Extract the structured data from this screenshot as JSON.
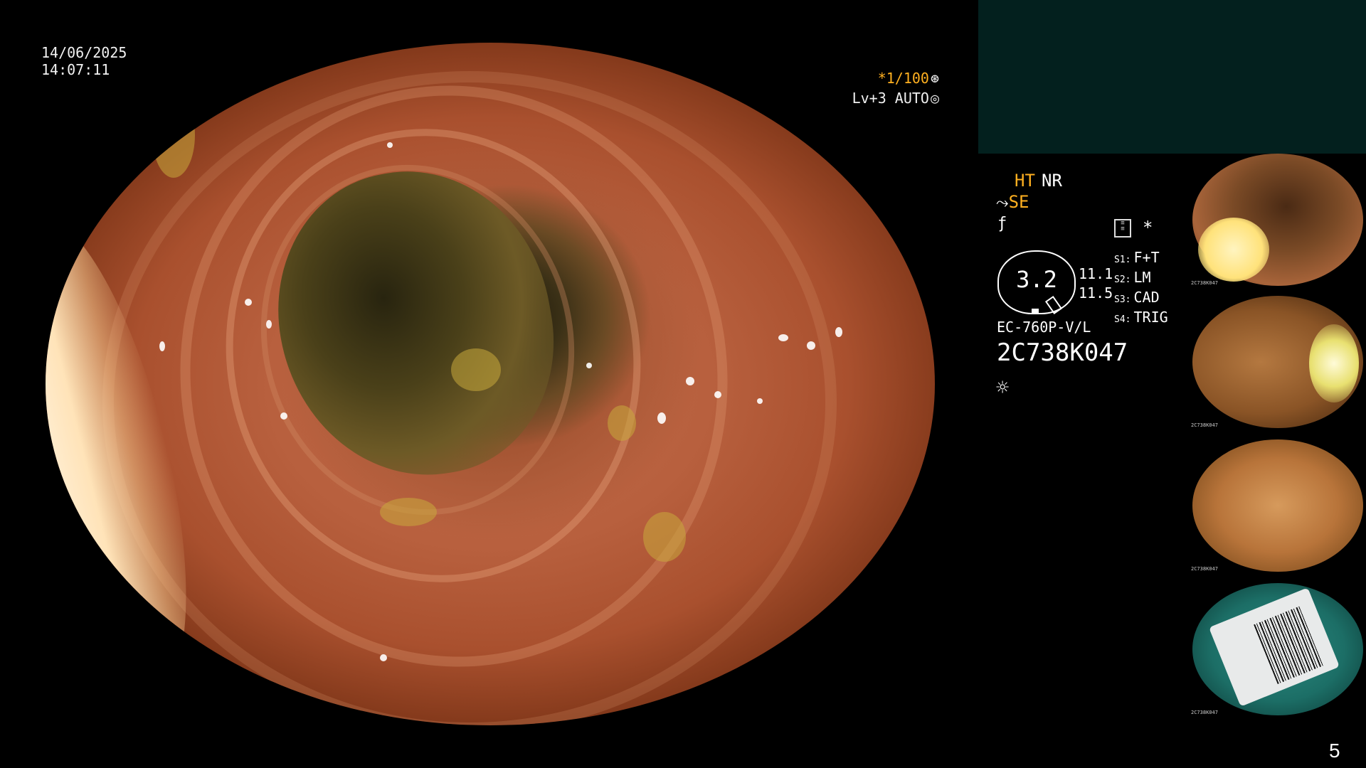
{
  "overlay": {
    "date": "14/06/2025",
    "time": "14:07:11",
    "shutter": "*1/100",
    "shutter_icon": "aperture-icon",
    "iris": "Lv+3 AUTO",
    "iris_icon": "iris-icon"
  },
  "status": {
    "ht": "HT",
    "nr": "NR",
    "se": "SE",
    "se_icon": "scope-icon",
    "f_icon": "f-icon",
    "memo_icon": "memo-icon",
    "star": "*"
  },
  "gauge": {
    "value": "3.2",
    "side_values": [
      "11.1",
      "11.5"
    ]
  },
  "modes": [
    {
      "key": "S1:",
      "value": "F+T"
    },
    {
      "key": "S2:",
      "value": "LM"
    },
    {
      "key": "S3:",
      "value": "CAD"
    },
    {
      "key": "S4:",
      "value": "TRIG"
    }
  ],
  "scope": {
    "model": "EC-760P-V/L",
    "serial": "2C738K047",
    "light_icon": "sun-icon"
  },
  "thumbnails": [
    {
      "label": "2C738K047"
    },
    {
      "label": "2C738K047"
    },
    {
      "label": "2C738K047"
    },
    {
      "label": "2C738K047"
    }
  ],
  "page_number": "5",
  "colors": {
    "accent": "#ffb020",
    "teal_panel": "#03201e",
    "background": "#000000"
  }
}
